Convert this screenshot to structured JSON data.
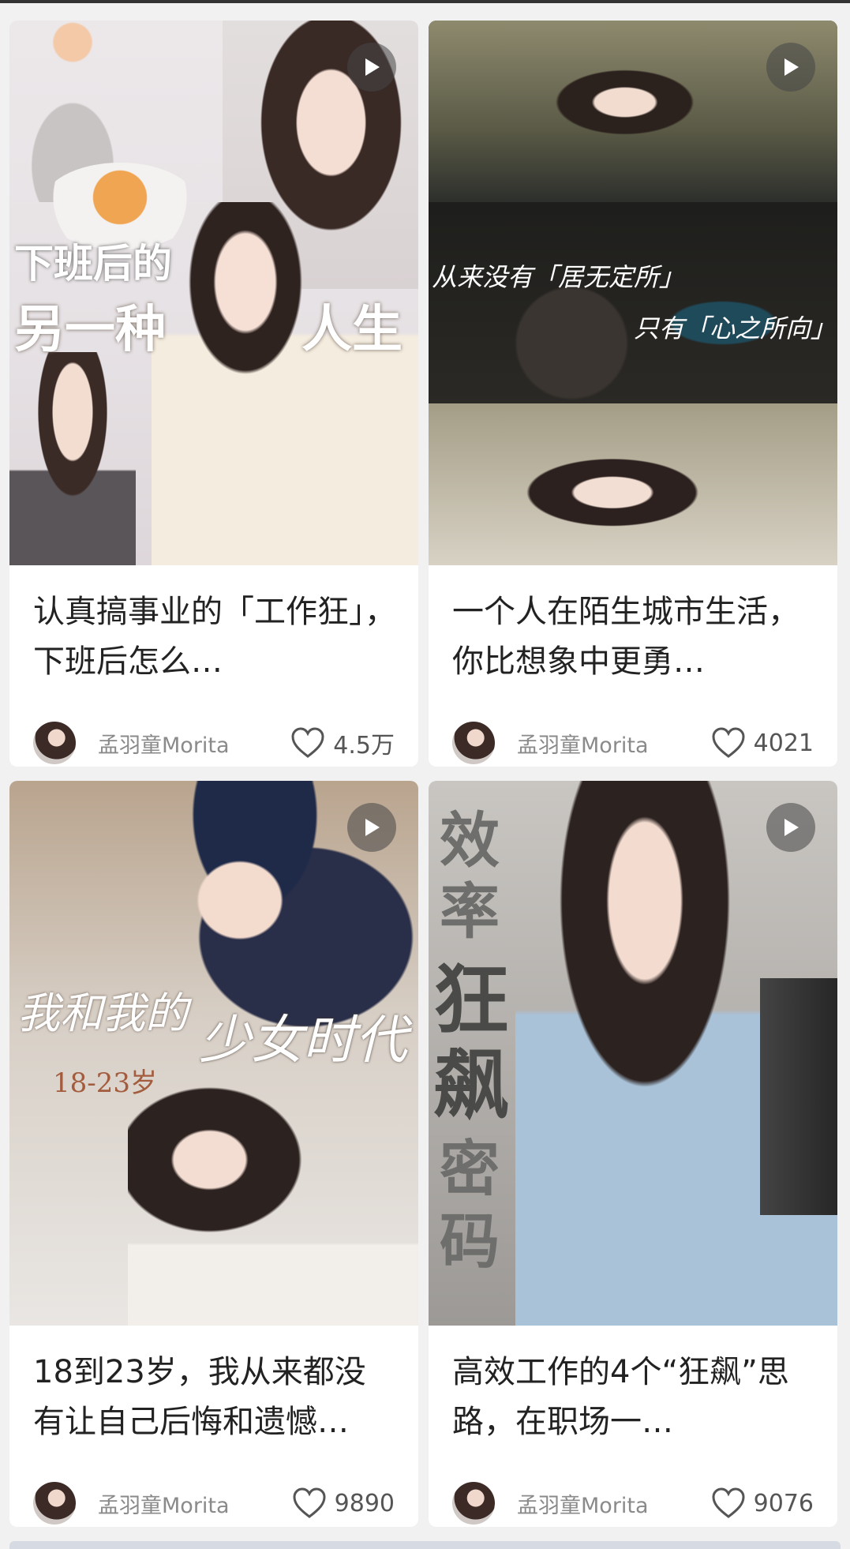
{
  "cards": [
    {
      "title": "认真搞事业的「工作狂」，下班后怎么…",
      "author": "孟羽童Morita",
      "likes": "4.5万",
      "cover_text": {
        "line1": "下班后的",
        "line2a": "另一种",
        "line2b": "人生"
      }
    },
    {
      "title": "一个人在陌生城市生活，你比想象中更勇…",
      "author": "孟羽童Morita",
      "likes": "4021",
      "cover_text": {
        "line1": "从来没有「居无定所」",
        "line2": "只有「心之所向」"
      }
    },
    {
      "title": "18到23岁，我从来都没有让自己后悔和遗憾…",
      "author": "孟羽童Morita",
      "likes": "9890",
      "cover_text": {
        "line1a": "我和我的",
        "line1b": "少女时代",
        "line2": "18-23岁"
      }
    },
    {
      "title": "高效工作的4个“狂飙”思路，在职场一…",
      "author": "孟羽童Morita",
      "likes": "9076",
      "cover_text": {
        "a": "效",
        "b": "率",
        "c": "狂",
        "d": "飙",
        "e": "密",
        "f": "码"
      }
    }
  ],
  "icons": {
    "play": "play-icon",
    "heart": "heart-icon"
  },
  "colors": {
    "background": "#f1f1f1",
    "card": "#ffffff",
    "text": "#222222",
    "muted": "#8a8a8a"
  }
}
